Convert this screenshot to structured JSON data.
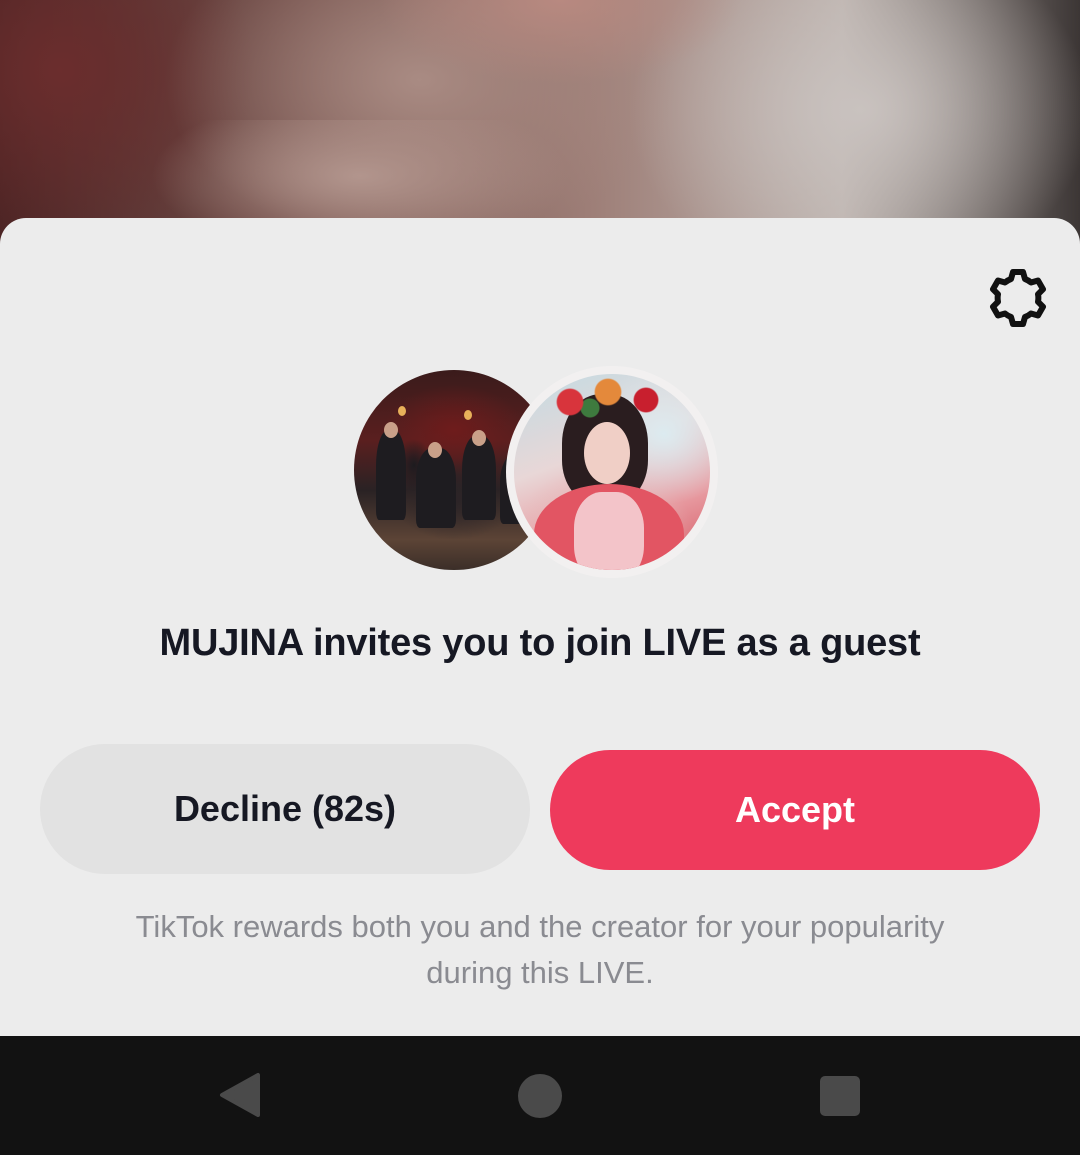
{
  "invite": {
    "headline": "MUJINA invites you to join LIVE as a guest",
    "decline_label": "Decline (82s)",
    "accept_label": "Accept",
    "footnote": "TikTok rewards both you and the creator for your popularity during this LIVE."
  },
  "icons": {
    "settings": "gear-icon",
    "back": "back-triangle-icon",
    "home": "home-circle-icon",
    "recents": "recents-square-icon"
  },
  "colors": {
    "accent": "#ee3a5c",
    "sheet_background": "#ececec",
    "decline_background": "#e2e2e2",
    "navbar_background": "#121212"
  }
}
